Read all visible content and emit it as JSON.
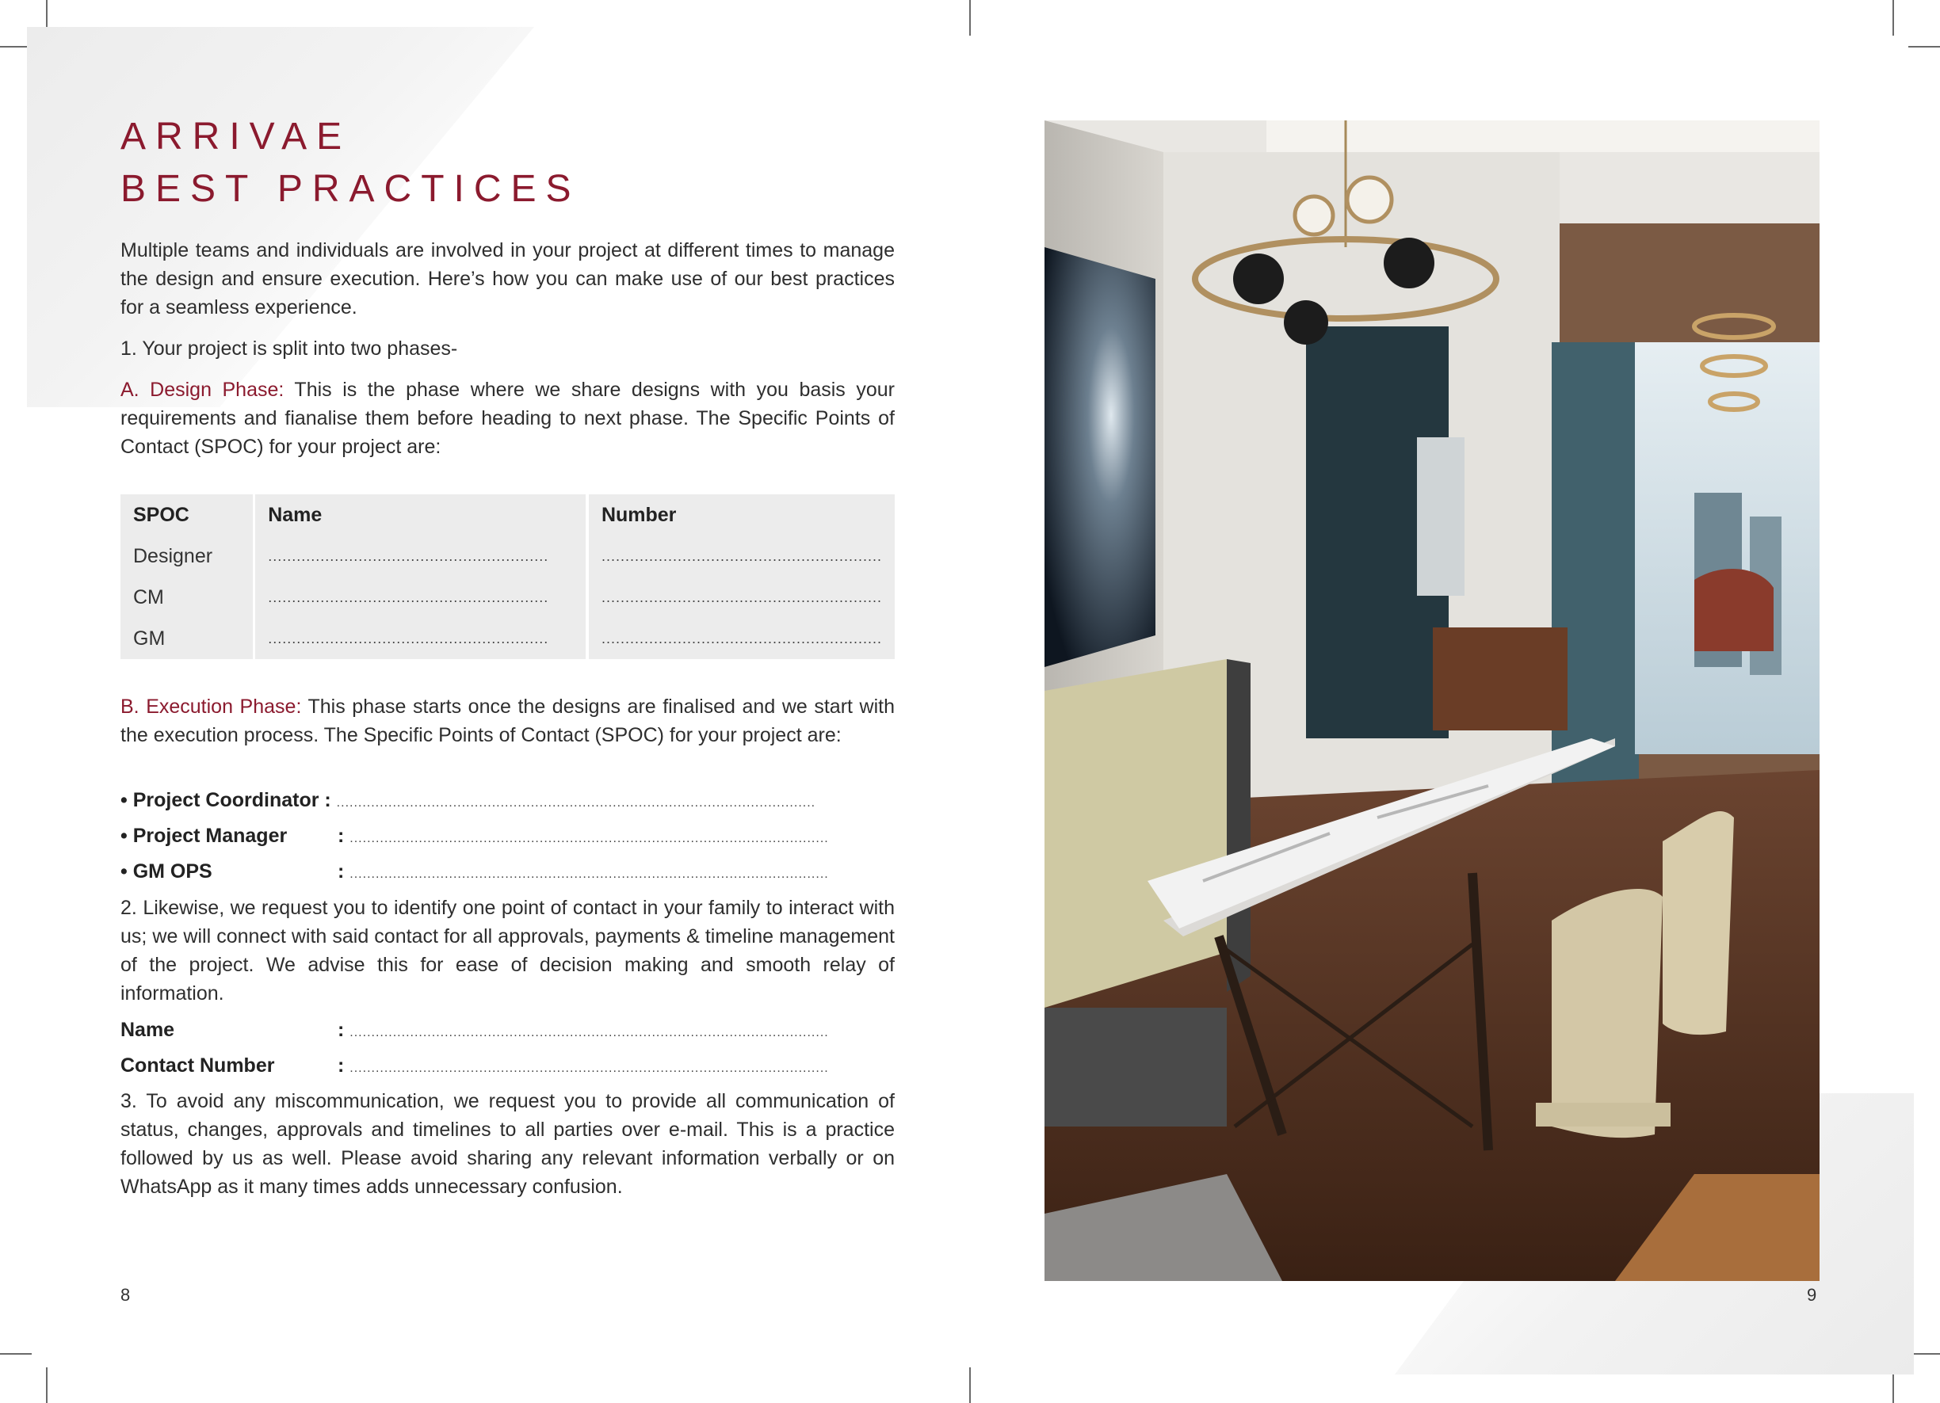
{
  "heading": {
    "line1": "ARRIVAE",
    "line2": "BEST PRACTICES"
  },
  "intro": "Multiple teams and individuals are involved in your project at different times to manage the design and ensure execution. Here’s how you can make use of our best practices for a seamless experience.",
  "point1": "1. Your project is split into two phases-",
  "design_phase": {
    "label": "A. Design Phase:",
    "text": " This is the phase where we share designs with you basis your requirements and fianalise them before heading to next phase. The Specific Points of Contact (SPOC) for your project are:"
  },
  "spoc_table": {
    "headers": [
      "SPOC",
      "Name",
      "Number"
    ],
    "rows": [
      {
        "role": "Designer",
        "name": "...........................................................",
        "number": "..........................................................."
      },
      {
        "role": "CM",
        "name": "...........................................................",
        "number": "..........................................................."
      },
      {
        "role": "GM",
        "name": "...........................................................",
        "number": "..........................................................."
      }
    ]
  },
  "execution_phase": {
    "label": "B. Execution Phase:",
    "text": " This phase starts once the designs are finalised and we start with the execution process. The Specific Points of Contact (SPOC) for your project are:"
  },
  "contacts": [
    {
      "label": "• Project Coordinator :",
      "dots": "..............................................................................................................."
    },
    {
      "label": "• Project Manager",
      "colon": ":",
      "dots": "..............................................................................................................."
    },
    {
      "label": "• GM OPS",
      "colon": ":",
      "dots": "..............................................................................................................."
    }
  ],
  "point2": "2. Likewise, we request you to identify one point of contact in your family to interact with us; we will connect with said contact for all approvals, payments & timeline management of the project. We advise this for ease of decision making and smooth relay of information.",
  "family_contact": [
    {
      "label": "Name",
      "colon": ":",
      "dots": "..............................................................................................................."
    },
    {
      "label": "Contact Number",
      "colon": ":",
      "dots": "..............................................................................................................."
    }
  ],
  "point3": "3. To avoid any miscommunication, we request you to provide all communication of status, changes, approvals and timelines to all parties over e-mail. This is a practice followed by us as well. Please avoid sharing any relevant information verbally or on WhatsApp as it many times adds unnecessary confusion.",
  "page_numbers": {
    "left": "8",
    "right": "9"
  },
  "colors": {
    "accent": "#8b1a2e",
    "table_bg": "#ececec"
  },
  "photo": {
    "subject": "dining-room-interior-render"
  }
}
